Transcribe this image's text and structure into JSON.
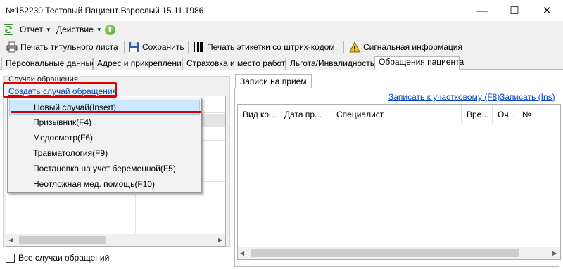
{
  "window": {
    "title": "№152230 Тестовый Пациент Взрослый 15.11.1986",
    "controls": {
      "minimize": "—",
      "maximize": "☐",
      "close": "✕"
    }
  },
  "menu": {
    "report": "Отчет",
    "action": "Действие"
  },
  "toolbar": {
    "print_title": "Печать титульного листа",
    "save": "Сохранить",
    "print_barcode": "Печать этикетки со штрих-кодом",
    "signal_info": "Сигнальная информация"
  },
  "tabs": [
    {
      "label": "Персональные данные"
    },
    {
      "label": "Адрес и прикрепление"
    },
    {
      "label": "Страховка и место работы"
    },
    {
      "label": "Льгота/Инвалидность"
    },
    {
      "label": "Обращения пациента",
      "active": true
    }
  ],
  "left": {
    "group_title": "Случаи обращения",
    "create_link": "Создать случай обращения",
    "all_cases_label": "Все случаи обращений",
    "all_cases_checked": false
  },
  "dropdown": {
    "items": [
      {
        "label": "Новый случай(Insert)",
        "selected": true
      },
      {
        "label": "Призывник(F4)"
      },
      {
        "label": "Медосмотр(F6)"
      },
      {
        "label": "Травматология(F9)"
      },
      {
        "label": "Постановка на учет беременной(F5)"
      },
      {
        "label": "Неотложная мед. помощь(F10)"
      }
    ]
  },
  "right": {
    "tab_label": "Записи на прием",
    "link_uchastok": "Записать к участковому (F8)",
    "link_zapisat": "Записать (Ins)",
    "columns": [
      "Вид ко...",
      "Дата пр...",
      "Специалист",
      "Вре...",
      "Оч...",
      "№"
    ]
  },
  "colors": {
    "highlight_red": "#e00000",
    "link_blue": "#0645c8",
    "selection_bg": "#cce8ff"
  }
}
